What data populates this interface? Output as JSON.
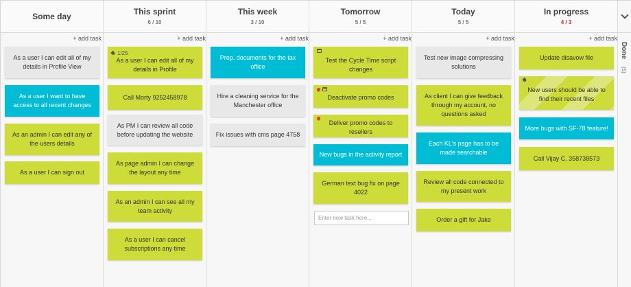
{
  "columns": [
    {
      "title": "Some day",
      "count": "",
      "add": "+ add task"
    },
    {
      "title": "This sprint",
      "count": "6 / 10",
      "add": "+ add task"
    },
    {
      "title": "This week",
      "count": "3 / 10",
      "add": "+ add task"
    },
    {
      "title": "Tomorrow",
      "count": "5 / 5",
      "add": "+ add task"
    },
    {
      "title": "Today",
      "count": "5 / 5",
      "add": "+ add task"
    },
    {
      "title": "In progress",
      "count": "4 / 3",
      "add": "+ add task"
    }
  ],
  "cards": {
    "someday": [
      "As a user I can edit all of my details in Profile View",
      "As a user I want to have access to all recent changes",
      "As an admin I can edit any of the users details",
      "As a user I can sign out"
    ],
    "sprint": [
      {
        "text": "As a user I can edit all of my details in Profile",
        "meta": "1/25"
      },
      "Call Morty 9252458978",
      "As PM I can review all code before updating the website",
      "As page admin I can change the layout any time",
      "As an admin I can see all my team activity",
      "As a user I can cancel subscriptions any time"
    ],
    "week": [
      "Prep. documents for the tax office",
      "Hire a cleaning service for the Manchester office",
      "Fix issues with cms page 4758"
    ],
    "tomorrow": [
      "Test the Cycle Time script changes",
      "Deactivate promo codes",
      "Deliver promo codes to resellers",
      "New bugs in the activity report",
      "German text bug fix on page 4022"
    ],
    "today": [
      "Test new image compressing solutions",
      "As client I can give feedback through my account, no questions asked",
      "Each KL's page has to be made searchable",
      "Review all code connected to my present work",
      "Order a gift for Jake"
    ],
    "progress": [
      "Update disavow file",
      "New users should be able to find their recent files",
      "More bugs with SF-78 feature!",
      "Call Vijay C. 358738573"
    ]
  },
  "new_task_placeholder": "Enter new task here...",
  "done": {
    "label": "Done",
    "count": "(5)"
  },
  "colors": {
    "lime": "#cddc39",
    "cyan": "#00bcd4",
    "gray": "#e8e8e8",
    "over_limit": "#e02424"
  }
}
